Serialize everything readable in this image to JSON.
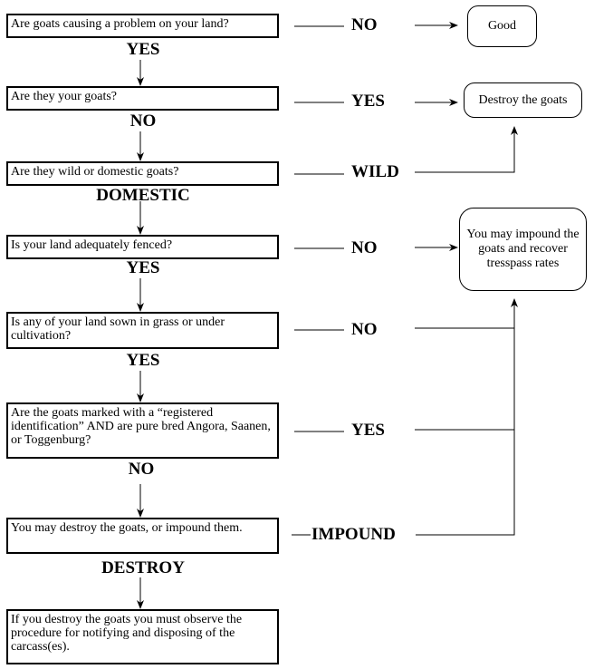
{
  "questions": [
    {
      "text": "Are goats causing a problem on your land?",
      "down_label": "YES",
      "side_label": "NO"
    },
    {
      "text": "Are they your goats?",
      "down_label": "NO",
      "side_label": "YES"
    },
    {
      "text": "Are they wild or domestic goats?",
      "down_label": "DOMESTIC",
      "side_label": "WILD"
    },
    {
      "text": "Is your land adequately fenced?",
      "down_label": "YES",
      "side_label": "NO"
    },
    {
      "text": "Is any of your land sown in grass or under cultivation?",
      "down_label": "YES",
      "side_label": "NO"
    },
    {
      "text": "Are the goats marked with a “registered identification” AND are pure bred Angora, Saanen, or Toggenburg?",
      "down_label": "NO",
      "side_label": "YES"
    },
    {
      "text": "You may destroy the goats, or impound them.",
      "down_label": "DESTROY",
      "side_label": "IMPOUND"
    }
  ],
  "final_step": {
    "text": "If you destroy the goats you must observe the procedure for notifying and disposing of the carcass(es)."
  },
  "outcomes": {
    "good": "Good",
    "destroy": "Destroy the goats",
    "impound": "You may impound the goats and recover tresspass rates"
  }
}
